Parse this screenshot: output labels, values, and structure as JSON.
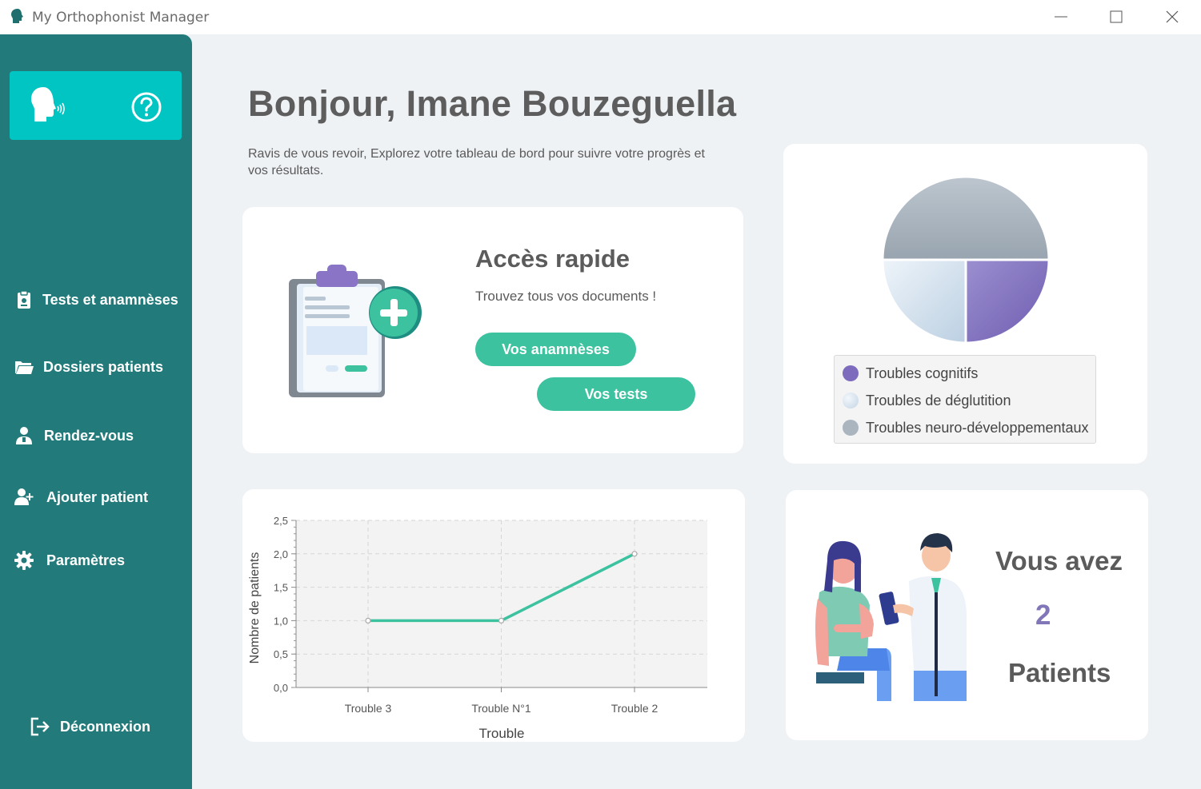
{
  "window": {
    "title": "My Orthophonist Manager"
  },
  "sidebar": {
    "items": [
      {
        "label": "Tests et anamnèses"
      },
      {
        "label": "Dossiers patients"
      },
      {
        "label": "Rendez-vous"
      },
      {
        "label": "Ajouter patient"
      },
      {
        "label": "Paramètres"
      }
    ],
    "logout": "Déconnexion"
  },
  "main": {
    "greeting": "Bonjour, Imane Bouzeguella",
    "subtitle": "Ravis de vous revoir, Explorez votre tableau de bord pour suivre votre progrès et vos résultats."
  },
  "quick_access": {
    "title": "Accès rapide",
    "subtitle": "Trouvez tous vos documents !",
    "btn_anamneses": "Vos anamnèses",
    "btn_tests": "Vos tests"
  },
  "pie_legend": [
    {
      "label": "Troubles cognitifs",
      "color": "#7d6cbd"
    },
    {
      "label": "Troubles de déglutition",
      "color": "#d4e1ee"
    },
    {
      "label": "Troubles neuro-développementaux",
      "color": "#aab5bf"
    }
  ],
  "patients_card": {
    "line1": "Vous avez",
    "count": "2",
    "line2": "Patients"
  },
  "chart_data": {
    "type": "line",
    "categories": [
      "Trouble 3",
      "Trouble N°1",
      "Trouble 2"
    ],
    "values": [
      1.0,
      1.0,
      2.0
    ],
    "xlabel": "Trouble",
    "ylabel": "Nombre de patients",
    "ylim": [
      0,
      2.5
    ],
    "yticks": [
      "0,0",
      "0,5",
      "1,0",
      "1,5",
      "2,0",
      "2,5"
    ],
    "grid": true,
    "line_color": "#3cc29f"
  },
  "pie_data": {
    "type": "pie",
    "labels": [
      "Troubles cognitifs",
      "Troubles de déglutition",
      "Troubles neuro-développementaux"
    ],
    "values": [
      1,
      1,
      2
    ]
  }
}
